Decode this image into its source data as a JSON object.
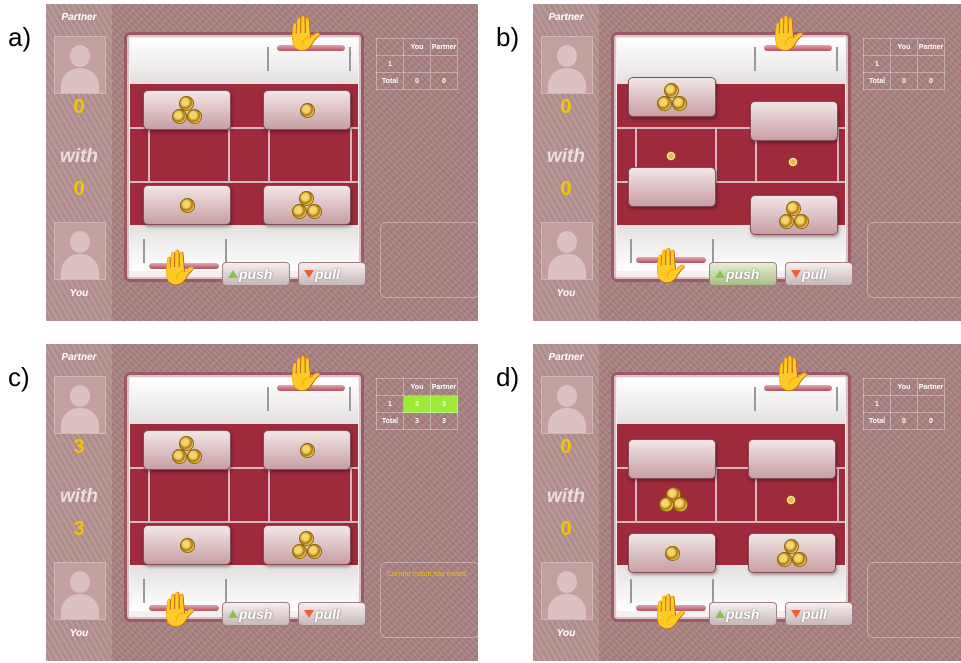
{
  "panel_labels": [
    "a)",
    "b)",
    "c)",
    "d)"
  ],
  "ui": {
    "partner_label": "Partner",
    "you_label": "You",
    "with_label": "with",
    "push_label": "push",
    "pull_label": "pull",
    "hand_glyph": "✋",
    "table_header_you": "You",
    "table_header_partner": "Partner",
    "table_total_label": "Total"
  },
  "panels": [
    {
      "partner_score": "0",
      "you_score": "0",
      "table": {
        "round": "1",
        "you": "",
        "partner": "",
        "total_you": "0",
        "total_partner": "0"
      },
      "message": ""
    },
    {
      "partner_score": "0",
      "you_score": "0",
      "table": {
        "round": "1",
        "you": "",
        "partner": "",
        "total_you": "0",
        "total_partner": "0"
      },
      "message": ""
    },
    {
      "partner_score": "3",
      "you_score": "3",
      "table": {
        "round": "1",
        "you": "3",
        "partner": "3",
        "total_you": "3",
        "total_partner": "3"
      },
      "message": "Current match has ended."
    },
    {
      "partner_score": "0",
      "you_score": "0",
      "table": {
        "round": "1",
        "you": "",
        "partner": "",
        "total_you": "0",
        "total_partner": "0"
      },
      "message": ""
    }
  ],
  "colors": {
    "score_yellow": "#f2c500",
    "highlight_green": "#9dea3a",
    "maroon": "#9e2a3c"
  }
}
